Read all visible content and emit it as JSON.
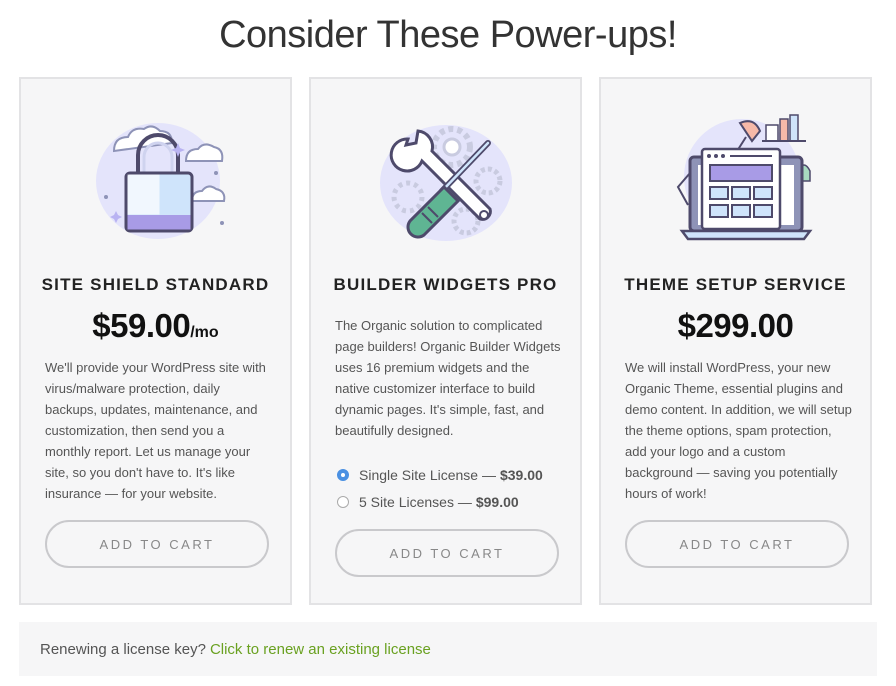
{
  "page": {
    "title": "Consider These Power-ups!"
  },
  "cards": [
    {
      "name": "SITE SHIELD STANDARD",
      "price": "$59.00",
      "price_suffix": "/mo",
      "description": "We'll provide your WordPress site with virus/malware protection, daily backups, updates, maintenance, and customization, then send you a monthly report. Let us manage your site, so you don't have to. It's like insurance — for your website.",
      "button_label": "ADD TO CART",
      "icon": "lock-icon"
    },
    {
      "name": "BUILDER WIDGETS PRO",
      "description": "The Organic solution to complicated page builders! Organic Builder Widgets uses 16 premium widgets and the native customizer interface to build dynamic pages. It's simple, fast, and beautifully designed.",
      "options": [
        {
          "label": "Single Site License —",
          "amount": "$39.00",
          "selected": true
        },
        {
          "label": "5 Site Licenses —",
          "amount": "$99.00",
          "selected": false
        }
      ],
      "button_label": "ADD TO CART",
      "icon": "tools-icon"
    },
    {
      "name": "THEME SETUP SERVICE",
      "price": "$299.00",
      "description": "We will install WordPress, your new Organic Theme, essential plugins and demo content. In addition, we will setup the theme options, spam protection, add your logo and a custom background — saving you potentially hours of work!",
      "button_label": "ADD TO CART",
      "icon": "laptop-icon"
    }
  ],
  "renew": {
    "text": "Renewing a license key?",
    "link_label": "Click to renew an existing license"
  },
  "colors": {
    "accent_blue": "#4a90e2",
    "link_green": "#6aa121",
    "card_bg": "#f6f6f7",
    "illustration_lavender": "#e4e4fb",
    "illustration_purple": "#6c5fc7"
  }
}
